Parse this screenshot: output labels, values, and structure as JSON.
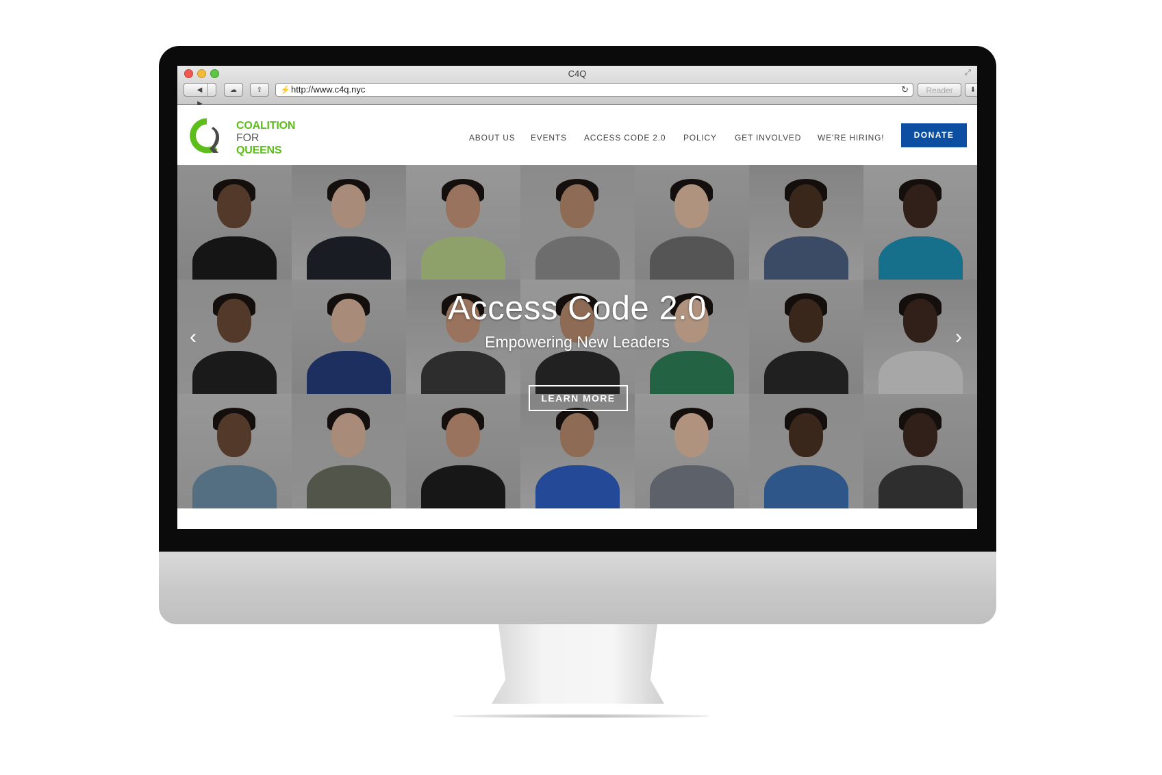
{
  "browser": {
    "window_title": "C4Q",
    "url": "http://www.c4q.nyc",
    "reader_label": "Reader"
  },
  "site": {
    "logo": {
      "line1": "COALITION",
      "line2": "FOR",
      "line3": "QUEENS"
    },
    "nav": [
      "ABOUT US",
      "EVENTS",
      "ACCESS CODE 2.0",
      "POLICY",
      "GET INVOLVED",
      "WE'RE HIRING!"
    ],
    "donate_label": "DONATE"
  },
  "hero": {
    "title": "Access Code 2.0",
    "subtitle": "Empowering New Leaders",
    "cta_label": "LEARN MORE"
  },
  "colors": {
    "brand_green": "#5cbd1b",
    "donate_blue": "#0b4ea2",
    "hero_bg": "#8e8e8e"
  },
  "icons": {
    "prev": "chevron-left-icon",
    "next": "chevron-right-icon",
    "reload": "reload-icon"
  }
}
